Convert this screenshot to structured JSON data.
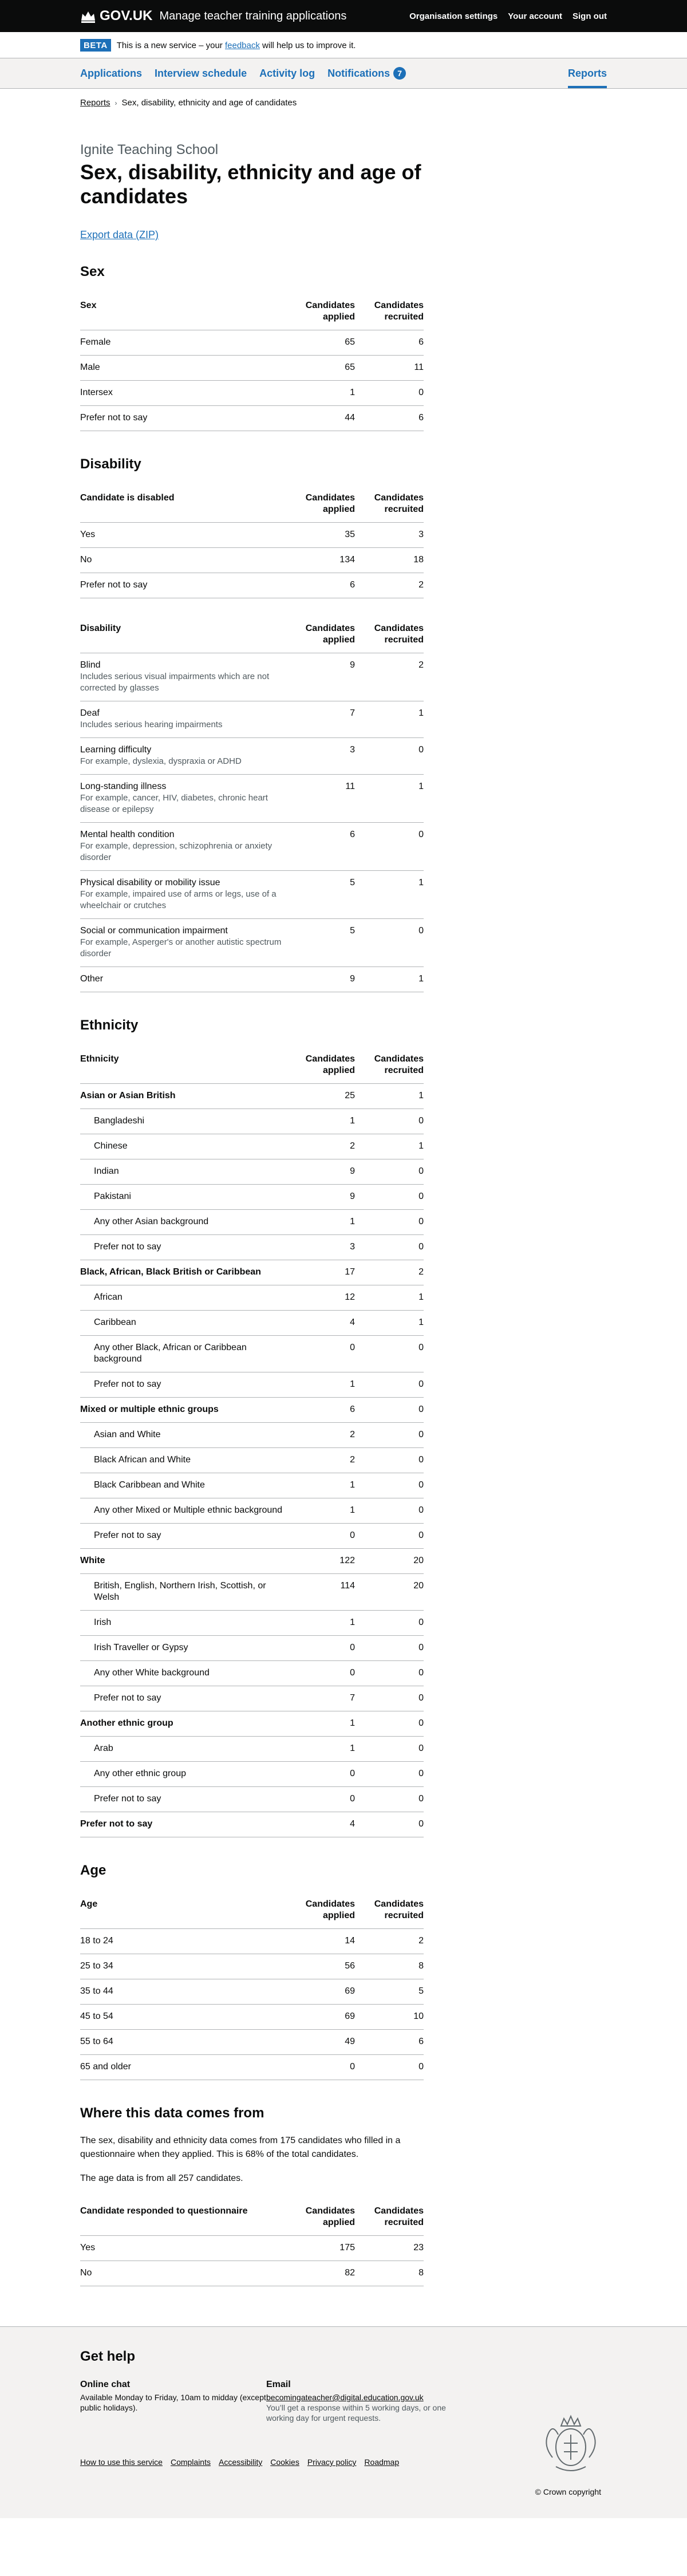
{
  "header": {
    "logo": "GOV.UK",
    "service": "Manage teacher training applications",
    "nav": [
      "Organisation settings",
      "Your account",
      "Sign out"
    ]
  },
  "phase": {
    "tag": "BETA",
    "text_before": "This is a new service – your",
    "link": "feedback",
    "text_after": "will help us to improve it."
  },
  "primary_nav": {
    "items": [
      "Applications",
      "Interview schedule",
      "Activity log",
      "Notifications"
    ],
    "notifications_count": "7",
    "right": "Reports"
  },
  "breadcrumbs": [
    "Reports",
    "Sex, disability, ethnicity and age of candidates"
  ],
  "page": {
    "caption": "Ignite Teaching School",
    "title": "Sex, disability, ethnicity and age of candidates",
    "export_link": "Export data (ZIP)"
  },
  "col_applied": "Candidates applied",
  "col_recruited": "Candidates recruited",
  "sex": {
    "heading": "Sex",
    "col": "Sex",
    "rows": [
      {
        "label": "Female",
        "applied": "65",
        "recruited": "6"
      },
      {
        "label": "Male",
        "applied": "65",
        "recruited": "11"
      },
      {
        "label": "Intersex",
        "applied": "1",
        "recruited": "0"
      },
      {
        "label": "Prefer not to say",
        "applied": "44",
        "recruited": "6"
      }
    ]
  },
  "disability": {
    "heading": "Disability",
    "col1": "Candidate is disabled",
    "rows1": [
      {
        "label": "Yes",
        "applied": "35",
        "recruited": "3"
      },
      {
        "label": "No",
        "applied": "134",
        "recruited": "18"
      },
      {
        "label": "Prefer not to say",
        "applied": "6",
        "recruited": "2"
      }
    ],
    "col2": "Disability",
    "rows2": [
      {
        "label": "Blind",
        "hint": "Includes serious visual impairments which are not corrected by glasses",
        "applied": "9",
        "recruited": "2"
      },
      {
        "label": "Deaf",
        "hint": "Includes serious hearing impairments",
        "applied": "7",
        "recruited": "1"
      },
      {
        "label": "Learning difficulty",
        "hint": "For example, dyslexia, dyspraxia or ADHD",
        "applied": "3",
        "recruited": "0"
      },
      {
        "label": "Long-standing illness",
        "hint": "For example, cancer, HIV, diabetes, chronic heart disease or epilepsy",
        "applied": "11",
        "recruited": "1"
      },
      {
        "label": "Mental health condition",
        "hint": "For example, depression, schizophrenia or anxiety disorder",
        "applied": "6",
        "recruited": "0"
      },
      {
        "label": "Physical disability or mobility issue",
        "hint": "For example, impaired use of arms or legs, use of a wheelchair or crutches",
        "applied": "5",
        "recruited": "1"
      },
      {
        "label": "Social or communication impairment",
        "hint": "For example, Asperger's or another autistic spectrum disorder",
        "applied": "5",
        "recruited": "0"
      },
      {
        "label": "Other",
        "hint": "",
        "applied": "9",
        "recruited": "1"
      }
    ]
  },
  "ethnicity": {
    "heading": "Ethnicity",
    "col": "Ethnicity",
    "rows": [
      {
        "label": "Asian or Asian British",
        "applied": "25",
        "recruited": "1",
        "group": true
      },
      {
        "label": "Bangladeshi",
        "applied": "1",
        "recruited": "0"
      },
      {
        "label": "Chinese",
        "applied": "2",
        "recruited": "1"
      },
      {
        "label": "Indian",
        "applied": "9",
        "recruited": "0"
      },
      {
        "label": "Pakistani",
        "applied": "9",
        "recruited": "0"
      },
      {
        "label": "Any other Asian background",
        "applied": "1",
        "recruited": "0"
      },
      {
        "label": "Prefer not to say",
        "applied": "3",
        "recruited": "0"
      },
      {
        "label": "Black, African, Black British or Caribbean",
        "applied": "17",
        "recruited": "2",
        "group": true
      },
      {
        "label": "African",
        "applied": "12",
        "recruited": "1"
      },
      {
        "label": "Caribbean",
        "applied": "4",
        "recruited": "1"
      },
      {
        "label": "Any other Black, African or Caribbean background",
        "applied": "0",
        "recruited": "0"
      },
      {
        "label": "Prefer not to say",
        "applied": "1",
        "recruited": "0"
      },
      {
        "label": "Mixed or multiple ethnic groups",
        "applied": "6",
        "recruited": "0",
        "group": true
      },
      {
        "label": "Asian and White",
        "applied": "2",
        "recruited": "0"
      },
      {
        "label": "Black African and White",
        "applied": "2",
        "recruited": "0"
      },
      {
        "label": "Black Caribbean and White",
        "applied": "1",
        "recruited": "0"
      },
      {
        "label": "Any other Mixed or Multiple ethnic background",
        "applied": "1",
        "recruited": "0"
      },
      {
        "label": "Prefer not to say",
        "applied": "0",
        "recruited": "0"
      },
      {
        "label": "White",
        "applied": "122",
        "recruited": "20",
        "group": true
      },
      {
        "label": "British, English, Northern Irish, Scottish, or Welsh",
        "applied": "114",
        "recruited": "20"
      },
      {
        "label": "Irish",
        "applied": "1",
        "recruited": "0"
      },
      {
        "label": "Irish Traveller or Gypsy",
        "applied": "0",
        "recruited": "0"
      },
      {
        "label": "Any other White background",
        "applied": "0",
        "recruited": "0"
      },
      {
        "label": "Prefer not to say",
        "applied": "7",
        "recruited": "0"
      },
      {
        "label": "Another ethnic group",
        "applied": "1",
        "recruited": "0",
        "group": true
      },
      {
        "label": "Arab",
        "applied": "1",
        "recruited": "0"
      },
      {
        "label": "Any other ethnic group",
        "applied": "0",
        "recruited": "0"
      },
      {
        "label": "Prefer not to say",
        "applied": "0",
        "recruited": "0"
      },
      {
        "label": "Prefer not to say",
        "applied": "4",
        "recruited": "0",
        "group": true
      }
    ]
  },
  "age": {
    "heading": "Age",
    "col": "Age",
    "rows": [
      {
        "label": "18 to 24",
        "applied": "14",
        "recruited": "2"
      },
      {
        "label": "25 to 34",
        "applied": "56",
        "recruited": "8"
      },
      {
        "label": "35 to 44",
        "applied": "69",
        "recruited": "5"
      },
      {
        "label": "45 to 54",
        "applied": "69",
        "recruited": "10"
      },
      {
        "label": "55 to 64",
        "applied": "49",
        "recruited": "6"
      },
      {
        "label": "65 and older",
        "applied": "0",
        "recruited": "0"
      }
    ]
  },
  "source": {
    "heading": "Where this data comes from",
    "para1": "The sex, disability and ethnicity data comes from 175 candidates who filled in a questionnaire when they applied. This is 68% of the total candidates.",
    "para2": "The age data is from all 257 candidates.",
    "col": "Candidate responded to questionnaire",
    "rows": [
      {
        "label": "Yes",
        "applied": "175",
        "recruited": "23"
      },
      {
        "label": "No",
        "applied": "82",
        "recruited": "8"
      }
    ]
  },
  "footer": {
    "heading": "Get help",
    "chat_title": "Online chat",
    "chat_text": "Available Monday to Friday, 10am to midday (except public holidays).",
    "email_title": "Email",
    "email": "becomingateacher@digital.education.gov.uk",
    "email_text": "You’ll get a response within 5 working days, or one working day for urgent requests.",
    "links": [
      "How to use this service",
      "Complaints",
      "Accessibility",
      "Cookies",
      "Privacy policy",
      "Roadmap"
    ],
    "copyright": "© Crown copyright"
  }
}
